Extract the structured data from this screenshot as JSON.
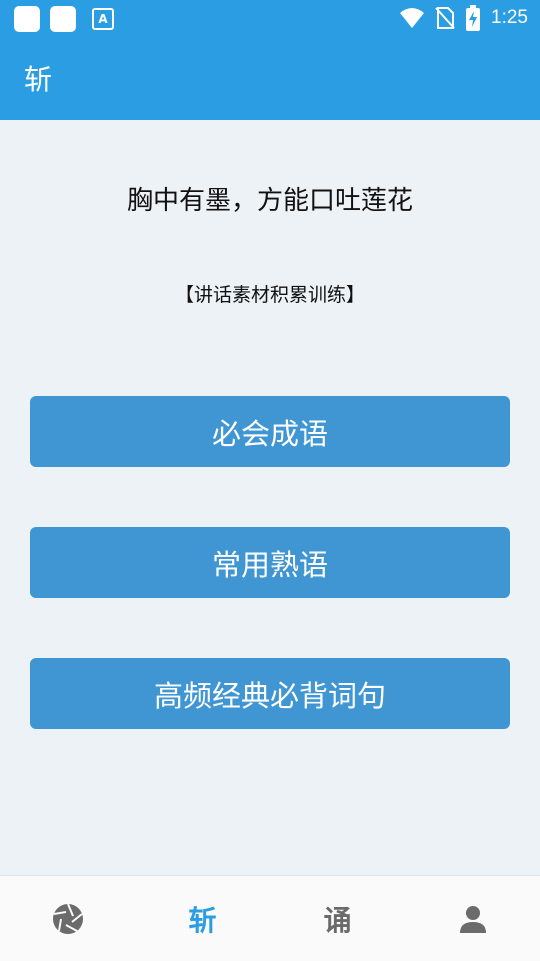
{
  "status_bar": {
    "time": "1:25",
    "icons": [
      "app-square-icon",
      "app-square-icon",
      "a-icon",
      "wifi-icon",
      "no-sim-icon",
      "battery-charging-icon"
    ]
  },
  "app_bar": {
    "title": "斩"
  },
  "main": {
    "motto": "胸中有墨，方能口吐莲花",
    "subtitle": "【讲话素材积累训练】",
    "buttons": [
      {
        "label": "必会成语"
      },
      {
        "label": "常用熟语"
      },
      {
        "label": "高频经典必背词句"
      }
    ]
  },
  "bottom_nav": {
    "items": [
      {
        "icon": "aperture-icon",
        "label": ""
      },
      {
        "label": "斩",
        "active": true
      },
      {
        "label": "诵",
        "active": false
      },
      {
        "icon": "person-icon",
        "label": ""
      }
    ]
  },
  "colors": {
    "primary": "#2b9ee3",
    "button": "#3f96d2",
    "background": "#edf2f7",
    "inactive_icon": "#6b6b6b"
  }
}
